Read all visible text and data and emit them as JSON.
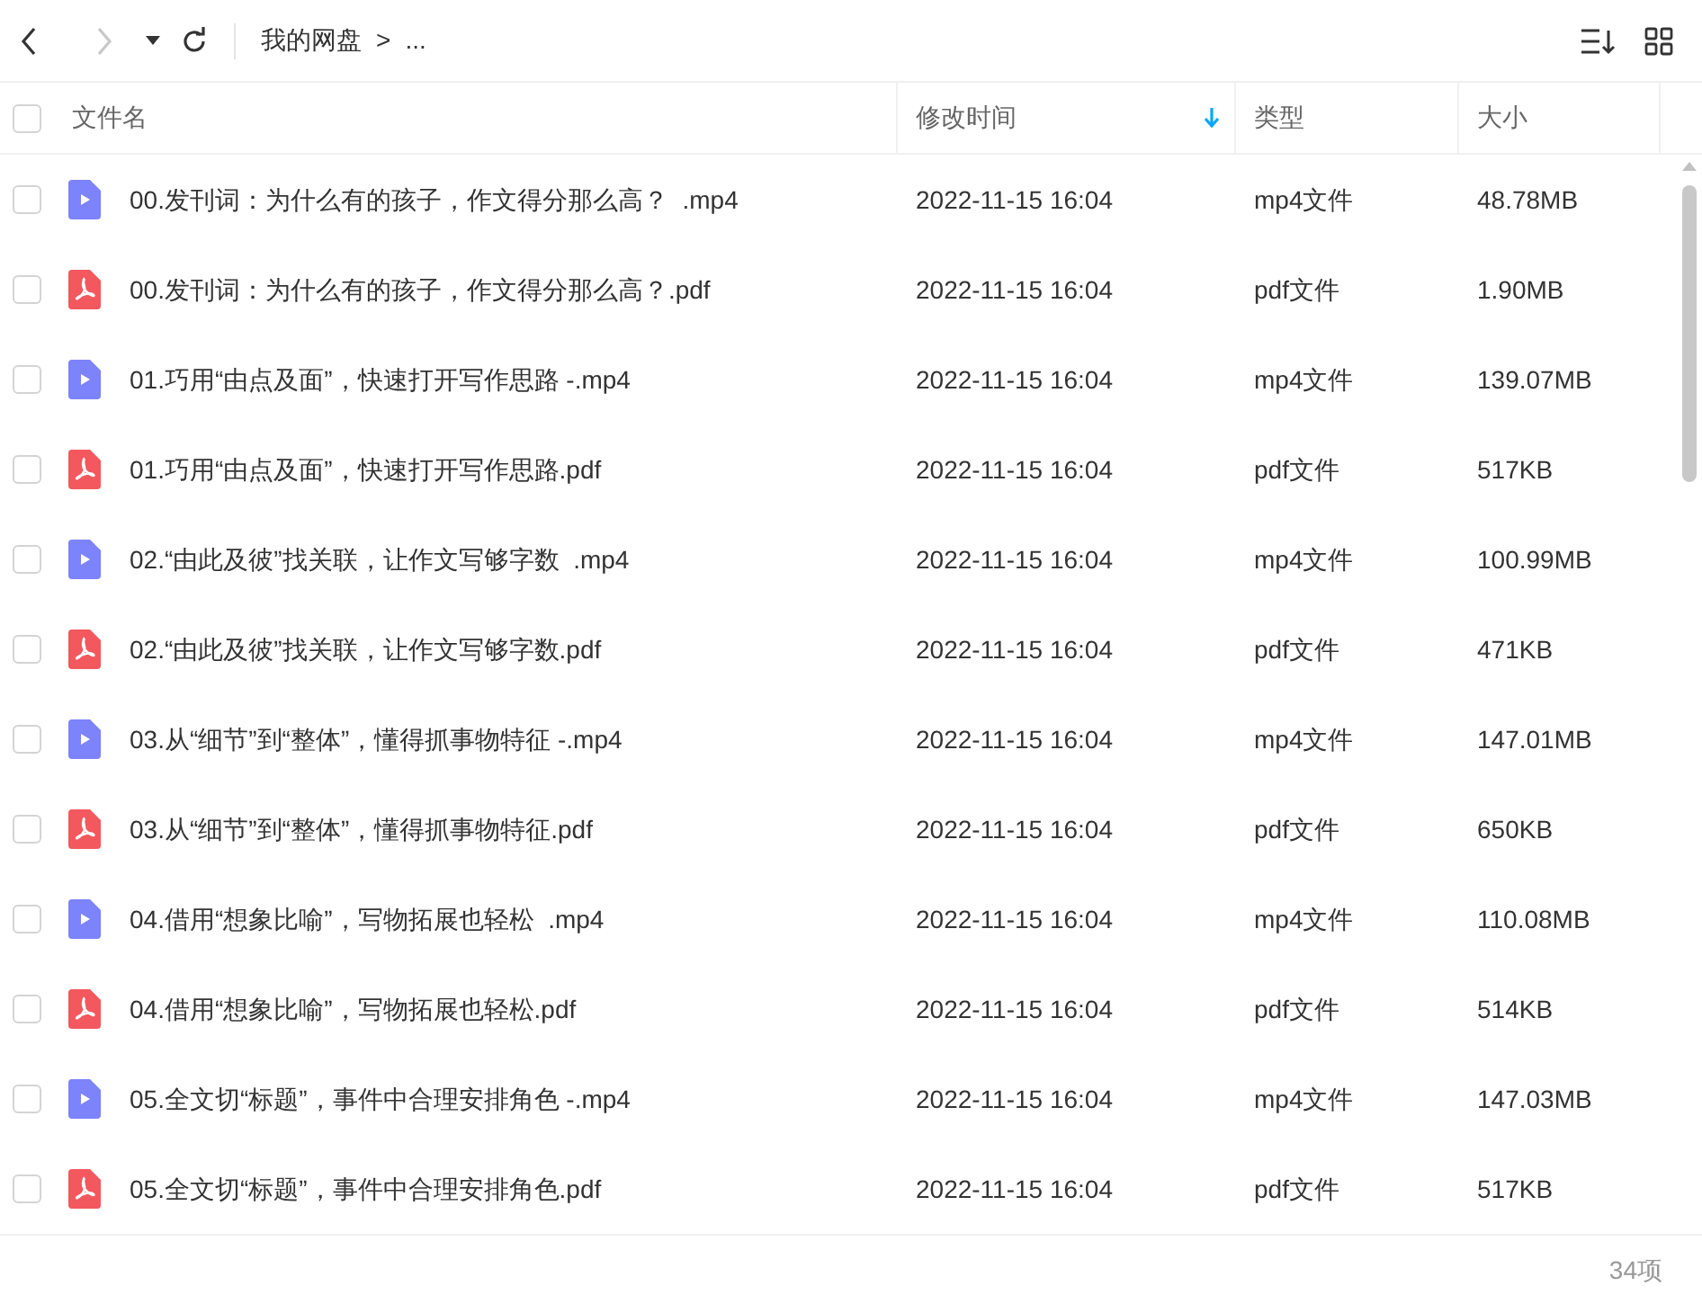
{
  "breadcrumb": {
    "root": "我的网盘",
    "separator": ">",
    "more": "..."
  },
  "table": {
    "select_all": {
      "checked": false
    },
    "columns": [
      {
        "label": "文件名",
        "sorted": false
      },
      {
        "label": "修改时间",
        "sorted": true
      },
      {
        "label": "类型",
        "sorted": false
      },
      {
        "label": "大小",
        "sorted": false
      }
    ],
    "rows": [
      {
        "kind": "video",
        "name": "00.发刊词：为什么有的孩子，作文得分那么高？  .mp4",
        "time": "2022-11-15 16:04",
        "type": "mp4文件",
        "size": "48.78MB",
        "checked": false
      },
      {
        "kind": "pdf",
        "name": "00.发刊词：为什么有的孩子，作文得分那么高？.pdf",
        "time": "2022-11-15 16:04",
        "type": "pdf文件",
        "size": "1.90MB",
        "checked": false
      },
      {
        "kind": "video",
        "name": "01.巧用“由点及面”，快速打开写作思路 -.mp4",
        "time": "2022-11-15 16:04",
        "type": "mp4文件",
        "size": "139.07MB",
        "checked": false
      },
      {
        "kind": "pdf",
        "name": "01.巧用“由点及面”，快速打开写作思路.pdf",
        "time": "2022-11-15 16:04",
        "type": "pdf文件",
        "size": "517KB",
        "checked": false
      },
      {
        "kind": "video",
        "name": "02.“由此及彼”找关联，让作文写够字数  .mp4",
        "time": "2022-11-15 16:04",
        "type": "mp4文件",
        "size": "100.99MB",
        "checked": false
      },
      {
        "kind": "pdf",
        "name": "02.“由此及彼”找关联，让作文写够字数.pdf",
        "time": "2022-11-15 16:04",
        "type": "pdf文件",
        "size": "471KB",
        "checked": false
      },
      {
        "kind": "video",
        "name": "03.从“细节”到“整体”，懂得抓事物特征 -.mp4",
        "time": "2022-11-15 16:04",
        "type": "mp4文件",
        "size": "147.01MB",
        "checked": false
      },
      {
        "kind": "pdf",
        "name": "03.从“细节”到“整体”，懂得抓事物特征.pdf",
        "time": "2022-11-15 16:04",
        "type": "pdf文件",
        "size": "650KB",
        "checked": false
      },
      {
        "kind": "video",
        "name": "04.借用“想象比喻”，写物拓展也轻松  .mp4",
        "time": "2022-11-15 16:04",
        "type": "mp4文件",
        "size": "110.08MB",
        "checked": false
      },
      {
        "kind": "pdf",
        "name": "04.借用“想象比喻”，写物拓展也轻松.pdf",
        "time": "2022-11-15 16:04",
        "type": "pdf文件",
        "size": "514KB",
        "checked": false
      },
      {
        "kind": "video",
        "name": "05.全文切“标题”，事件中合理安排角色 -.mp4",
        "time": "2022-11-15 16:04",
        "type": "mp4文件",
        "size": "147.03MB",
        "checked": false
      },
      {
        "kind": "pdf",
        "name": "05.全文切“标题”，事件中合理安排角色.pdf",
        "time": "2022-11-15 16:04",
        "type": "pdf文件",
        "size": "517KB",
        "checked": false
      }
    ]
  },
  "status_bar": {
    "count": "34项"
  }
}
